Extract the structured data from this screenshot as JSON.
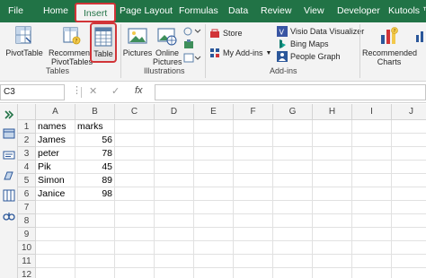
{
  "tabs": [
    {
      "label": "File",
      "active": false
    },
    {
      "label": "Home",
      "active": false
    },
    {
      "label": "Insert",
      "active": true
    },
    {
      "label": "Page Layout",
      "active": false
    },
    {
      "label": "Formulas",
      "active": false
    },
    {
      "label": "Data",
      "active": false
    },
    {
      "label": "Review",
      "active": false
    },
    {
      "label": "View",
      "active": false
    },
    {
      "label": "Developer",
      "active": false
    },
    {
      "label": "Kutools ™",
      "active": false
    }
  ],
  "ribbon": {
    "tables_group": {
      "label": "Tables",
      "pivottable": "PivotTable",
      "recommended_pivot_line1": "Recommended",
      "recommended_pivot_line2": "PivotTables",
      "table": "Table"
    },
    "illustrations_group": {
      "label": "Illustrations",
      "pictures": "Pictures",
      "online_pictures_line1": "Online",
      "online_pictures_line2": "Pictures"
    },
    "addins_group": {
      "label": "Add-ins",
      "store": "Store",
      "my_addins": "My Add-ins",
      "visio": "Visio Data Visualizer",
      "bing_maps": "Bing Maps",
      "people_graph": "People Graph"
    },
    "charts_group": {
      "recommended_charts_line1": "Recommended",
      "recommended_charts_line2": "Charts"
    }
  },
  "formula_bar": {
    "name_box": "C3",
    "cancel": "✕",
    "enter": "✓",
    "fx": "fx",
    "value": ""
  },
  "sheet": {
    "columns": [
      "A",
      "B",
      "C",
      "D",
      "E",
      "F",
      "G",
      "H",
      "I",
      "J"
    ],
    "rows": [
      "1",
      "2",
      "3",
      "4",
      "5",
      "6",
      "7",
      "8",
      "9",
      "10",
      "11",
      "12"
    ],
    "data": [
      [
        "names",
        "marks"
      ],
      [
        "James",
        "56"
      ],
      [
        "peter",
        "78"
      ],
      [
        "Pik",
        "45"
      ],
      [
        "Simon",
        "89"
      ],
      [
        "Janice",
        "98"
      ]
    ]
  },
  "colors": {
    "accent": "#217346",
    "highlight": "#d13438"
  }
}
